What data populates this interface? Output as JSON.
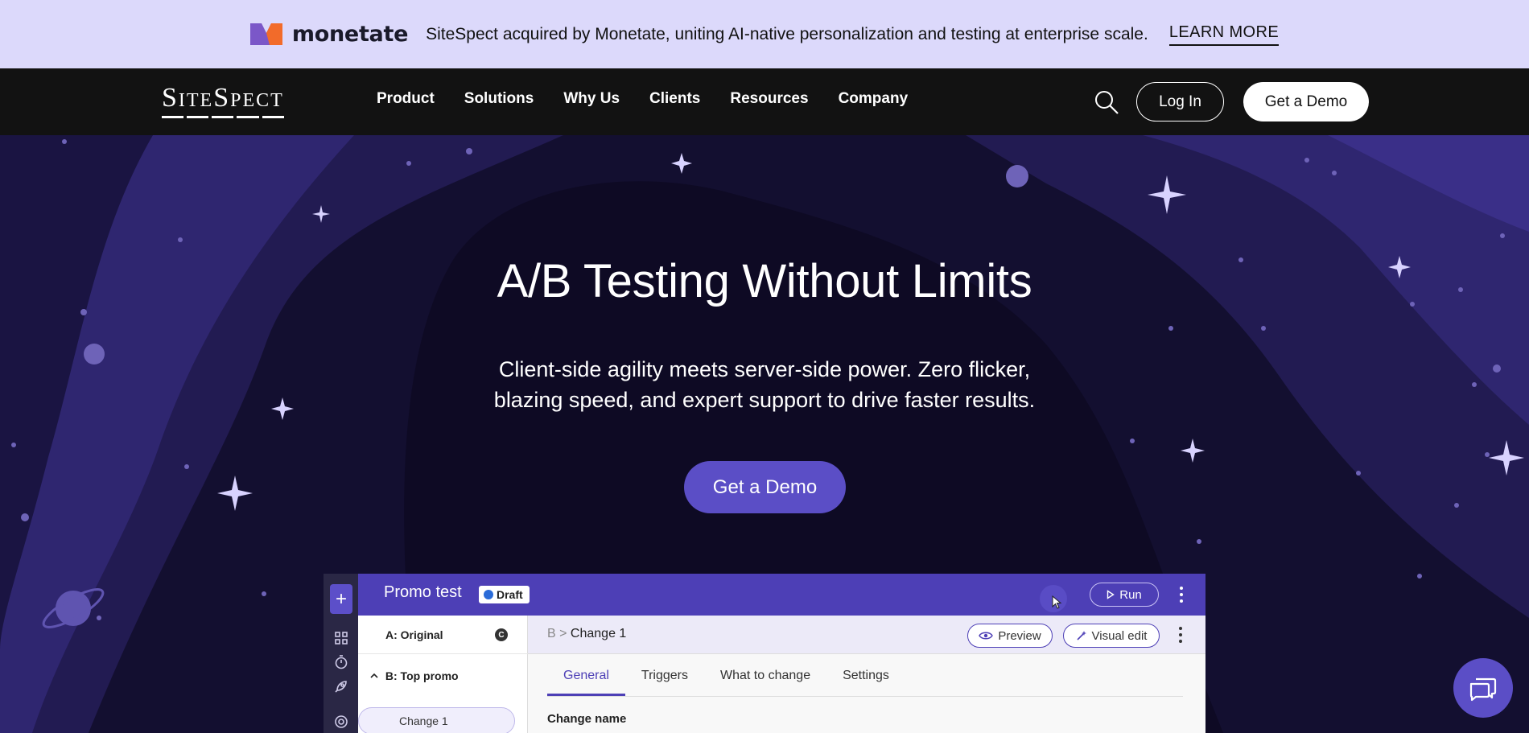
{
  "announcement": {
    "brand_name": "monetate",
    "text": "SiteSpect acquired by Monetate, uniting AI-native personalization and testing at enterprise scale.",
    "link_label": "LEARN MORE"
  },
  "nav": {
    "logo_text": "SiteSpect",
    "items": [
      "Product",
      "Solutions",
      "Why Us",
      "Clients",
      "Resources",
      "Company"
    ],
    "search_icon": "search-icon",
    "login_label": "Log In",
    "demo_label": "Get a Demo"
  },
  "hero": {
    "title": "A/B Testing Without Limits",
    "subtitle_line1": "Client-side agility meets server-side power. Zero flicker,",
    "subtitle_line2": "blazing speed, and expert support to drive faster results.",
    "cta_label": "Get a Demo"
  },
  "app_mock": {
    "test_name": "Promo test",
    "status_badge": "Draft",
    "run_label": "Run",
    "variant_a": "A: Original",
    "variant_a_badge": "C",
    "variant_b": "B: Top promo",
    "change_item": "Change 1",
    "breadcrumb_parent": "B",
    "breadcrumb_separator": ">",
    "breadcrumb_current": "Change 1",
    "preview_label": "Preview",
    "visual_edit_label": "Visual edit",
    "tabs": [
      "General",
      "Triggers",
      "What to change",
      "Settings"
    ],
    "active_tab": "General",
    "field_label": "Change name"
  },
  "colors": {
    "announcement_bg": "#dcd9fb",
    "nav_bg": "#121212",
    "hero_bg": "#100c28",
    "accent": "#5b4ec6",
    "app_header": "#4d3fb6",
    "monetate_orange": "#f26b2a",
    "monetate_purple": "#7b57c8"
  },
  "chat_widget_icon": "chat-bubbles-icon"
}
